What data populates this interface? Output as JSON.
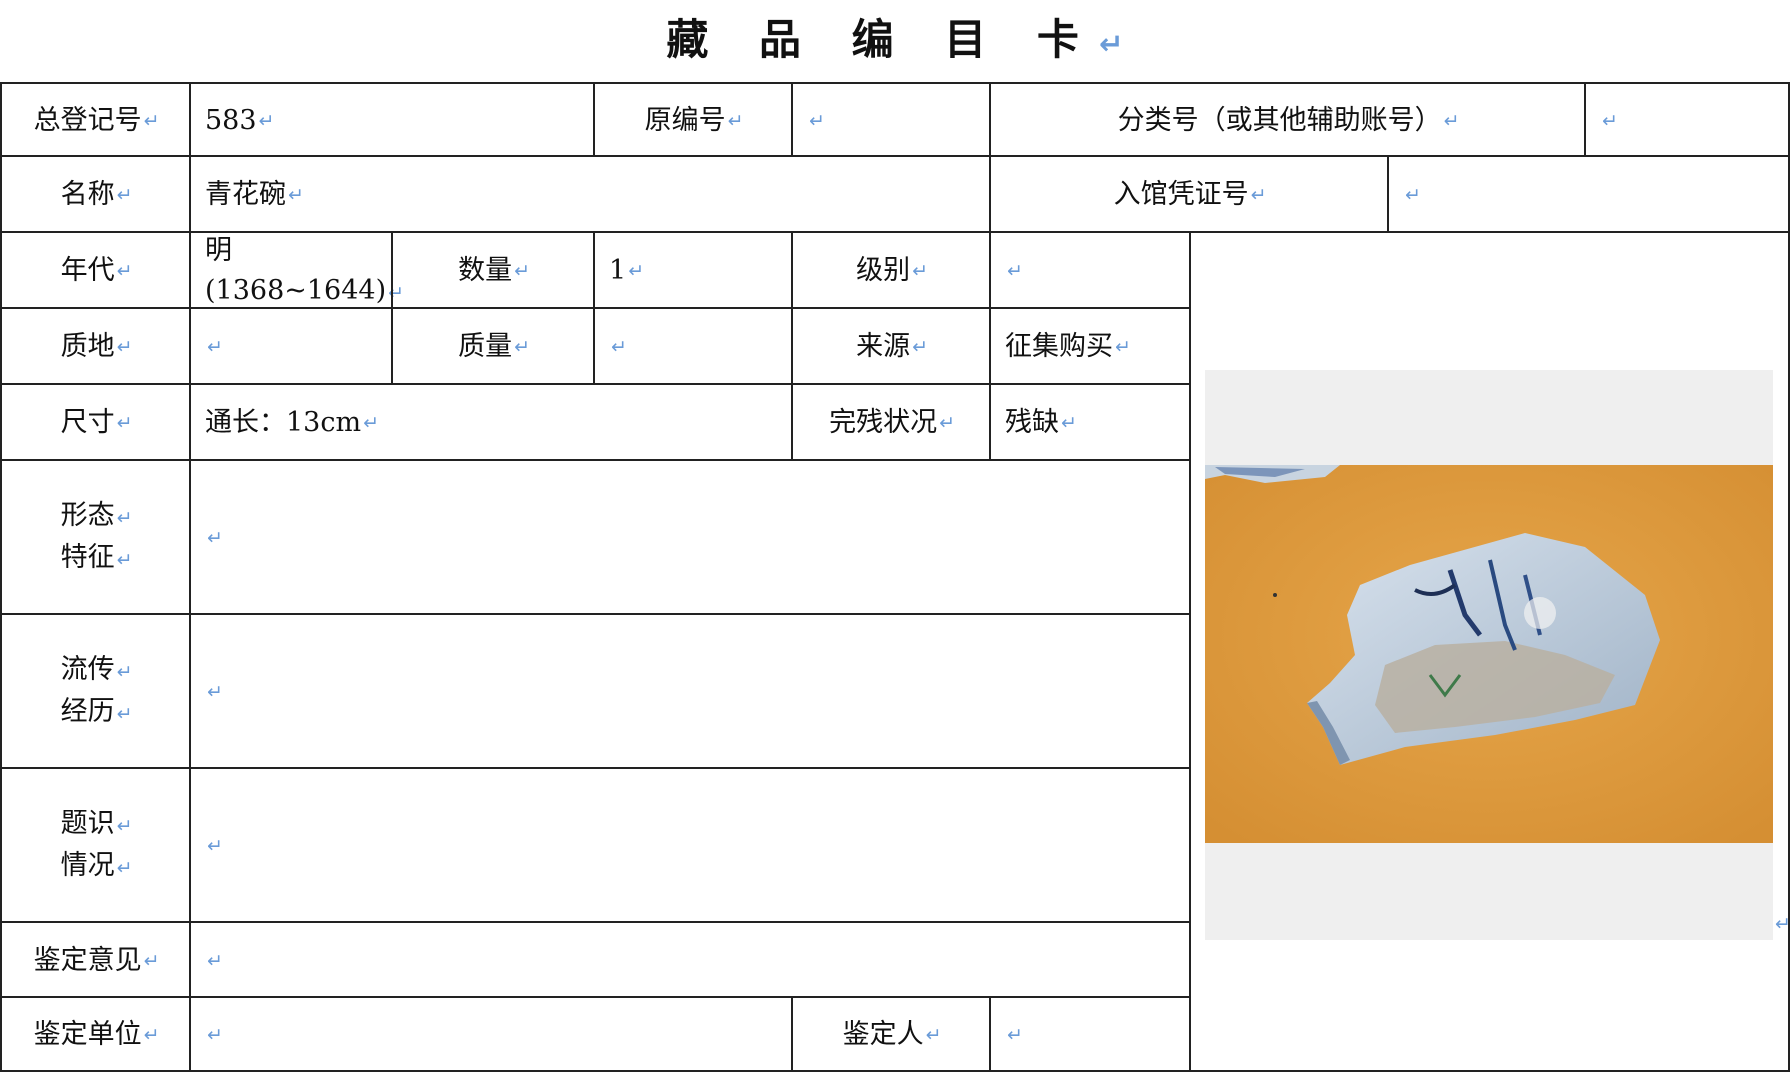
{
  "card_title": "藏 品 编 目 卡",
  "fields": {
    "total_reg_no": {
      "label": "总登记号",
      "value": "583"
    },
    "original_no": {
      "label": "原编号",
      "value": ""
    },
    "class_no": {
      "label": "分类号（或其他辅助账号）",
      "value": ""
    },
    "name": {
      "label": "名称",
      "value": "青花碗"
    },
    "entry_voucher": {
      "label": "入馆凭证号",
      "value": ""
    },
    "era": {
      "label": "年代",
      "value_line1": "明",
      "value_line2": "(1368~1644)"
    },
    "quantity": {
      "label": "数量",
      "value": "1"
    },
    "grade": {
      "label": "级别",
      "value": ""
    },
    "material": {
      "label": "质地",
      "value": ""
    },
    "weight": {
      "label": "质量",
      "value": ""
    },
    "source": {
      "label": "来源",
      "value": "征集购买"
    },
    "size": {
      "label": "尺寸",
      "value": "通长：13cm"
    },
    "condition": {
      "label": "完残状况",
      "value": "残缺"
    },
    "form": {
      "label_line1": "形态",
      "label_line2": "特征",
      "value": ""
    },
    "history": {
      "label_line1": "流传",
      "label_line2": "经历",
      "value": ""
    },
    "inscription": {
      "label_line1": "题识",
      "label_line2": "情况",
      "value": ""
    },
    "appraisal_opinion": {
      "label": "鉴定意见",
      "value": ""
    },
    "appraisal_unit": {
      "label": "鉴定单位",
      "value": ""
    },
    "appraiser": {
      "label": "鉴定人",
      "value": ""
    }
  },
  "colors": {
    "border": "#222222",
    "paragraph_mark": "#6a9bd8",
    "photo_bg": "#efefef",
    "orange_backdrop": "#e0a040"
  },
  "icons": {
    "paragraph_mark": "return-arrow-icon"
  }
}
